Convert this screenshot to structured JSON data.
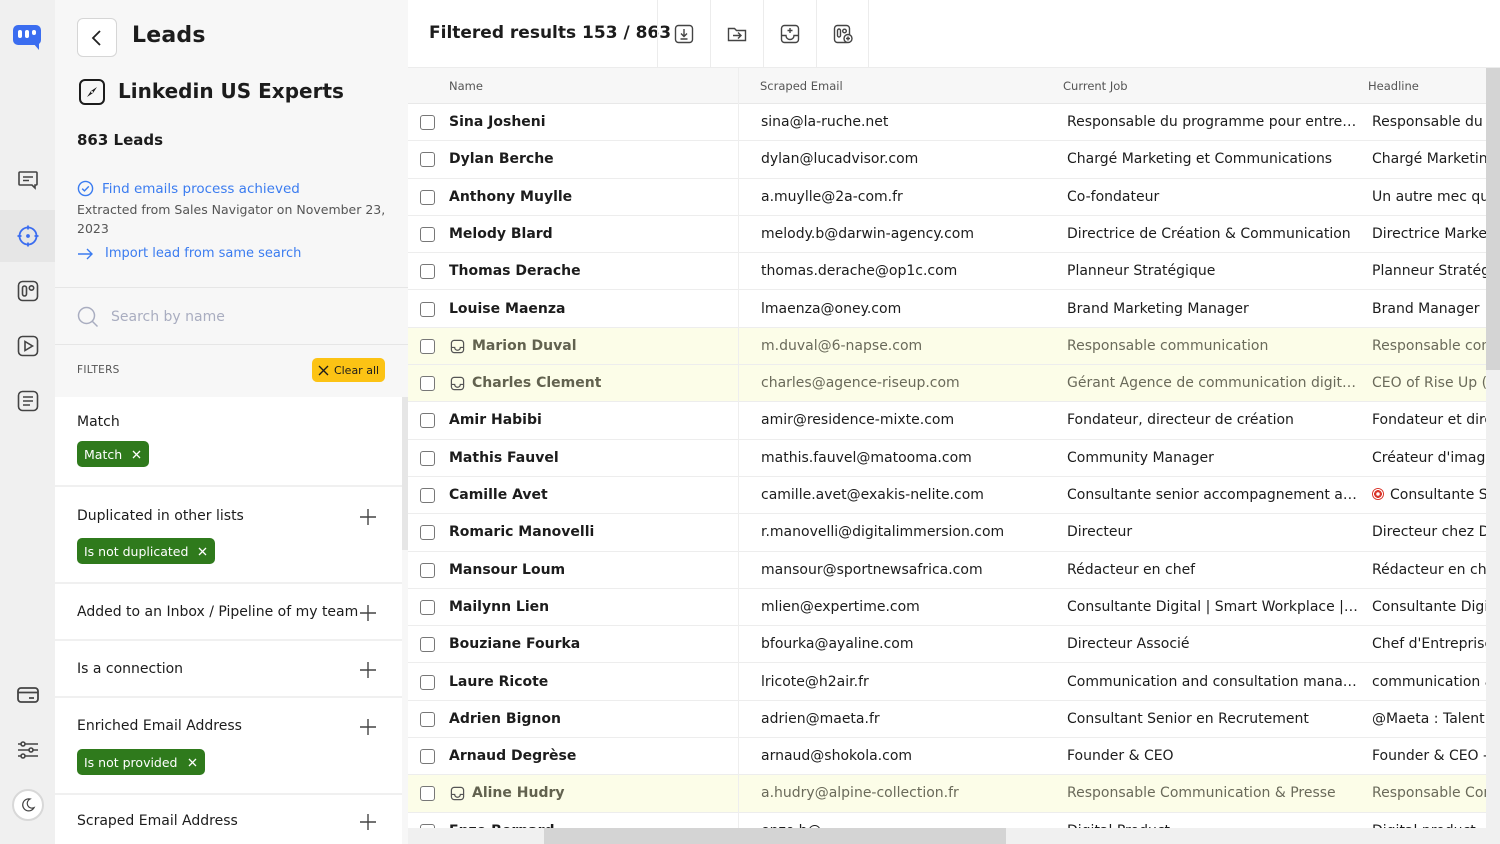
{
  "rail": {
    "items": [
      {
        "name": "messages",
        "icon": "chat-icon"
      },
      {
        "name": "prospecting",
        "icon": "target-icon",
        "active": true
      },
      {
        "name": "campaigns",
        "icon": "counter-icon"
      },
      {
        "name": "sequences",
        "icon": "play-icon"
      },
      {
        "name": "templates",
        "icon": "document-icon"
      },
      {
        "name": "billing",
        "icon": "credit-card-icon"
      },
      {
        "name": "settings",
        "icon": "sliders-icon"
      },
      {
        "name": "dark-mode",
        "icon": "moon-icon"
      }
    ],
    "accent": "#3b6df0"
  },
  "panel": {
    "title": "Leads",
    "list_name": "Linkedin US Experts",
    "lead_count": "863 Leads",
    "status": "Find emails process achieved",
    "extracted": "Extracted from Sales Navigator on November 23, 2023",
    "import_link": "Import lead from same search",
    "search_placeholder": "Search by name",
    "filters_label": "FILTERS",
    "clear_all": "Clear all",
    "filters": [
      {
        "label": "Match",
        "chip": "Match",
        "has_plus": false
      },
      {
        "label": "Duplicated in other lists",
        "chip": "Is not duplicated",
        "has_plus": true
      },
      {
        "label": "Added to an Inbox / Pipeline of my team",
        "chip": null,
        "has_plus": true
      },
      {
        "label": "Is a connection",
        "chip": null,
        "has_plus": true
      },
      {
        "label": "Enriched Email Address",
        "chip": "Is not provided",
        "has_plus": true
      },
      {
        "label": "Scraped Email Address",
        "chip": null,
        "has_plus": true
      }
    ]
  },
  "main": {
    "filtered_results": "Filtered results 153 / 863",
    "toolbar": [
      {
        "name": "export-button",
        "icon": "download-icon"
      },
      {
        "name": "move-to-list-button",
        "icon": "folder-arrow-icon"
      },
      {
        "name": "add-to-inbox-button",
        "icon": "inbox-plus-icon"
      },
      {
        "name": "add-to-campaign-button",
        "icon": "campaign-plus-icon"
      }
    ],
    "columns": [
      "Name",
      "Scraped Email",
      "Current Job",
      "Headline"
    ],
    "rows": [
      {
        "name": "Sina Josheni",
        "email": "sina@la-ruche.net",
        "job": "Responsable du programme pour entrepre...",
        "headline": "Responsable du p",
        "inbox": false
      },
      {
        "name": "Dylan Berche",
        "email": "dylan@lucadvisor.com",
        "job": "Chargé Marketing et Communications",
        "headline": "Chargé Marketing",
        "inbox": false
      },
      {
        "name": "Anthony Muylle",
        "email": "a.muylle@2a-com.fr",
        "job": "Co-fondateur",
        "headline": "Un autre mec qui",
        "inbox": false
      },
      {
        "name": "Melody Blard",
        "email": "melody.b@darwin-agency.com",
        "job": "Directrice de Création & Communication",
        "headline": "Directrice Market",
        "inbox": false
      },
      {
        "name": "Thomas Derache",
        "email": "thomas.derache@op1c.com",
        "job": "Planneur Stratégique",
        "headline": "Planneur Stratég",
        "inbox": false
      },
      {
        "name": "Louise Maenza",
        "email": "lmaenza@oney.com",
        "job": "Brand Marketing Manager",
        "headline": "Brand Manager",
        "inbox": false
      },
      {
        "name": "Marion Duval",
        "email": "m.duval@6-napse.com",
        "job": "Responsable communication",
        "headline": "Responsable com",
        "inbox": true
      },
      {
        "name": "Charles Clement",
        "email": "charles@agence-riseup.com",
        "job": "Gérant Agence de communication digitale",
        "headline": "CEO of Rise Up (D",
        "inbox": true
      },
      {
        "name": "Amir Habibi",
        "email": "amir@residence-mixte.com",
        "job": "Fondateur, directeur de création",
        "headline": "Fondateur et dire",
        "inbox": false
      },
      {
        "name": "Mathis Fauvel",
        "email": "mathis.fauvel@matooma.com",
        "job": "Community Manager",
        "headline": "Créateur d'image",
        "inbox": false
      },
      {
        "name": "Camille Avet",
        "email": "camille.avet@exakis-nelite.com",
        "job": "Consultante senior accompagnement au c...",
        "headline": "Consultante Se",
        "headline_emoji": true,
        "inbox": false
      },
      {
        "name": "Romaric Manovelli",
        "email": "r.manovelli@digitalimmersion.com",
        "job": "Directeur",
        "headline": "Directeur chez Di",
        "inbox": false
      },
      {
        "name": "Mansour Loum",
        "email": "mansour@sportnewsafrica.com",
        "job": "Rédacteur en chef",
        "headline": "Rédacteur en che",
        "inbox": false
      },
      {
        "name": "Mailynn Lien",
        "email": "mlien@expertime.com",
        "job": "Consultante Digital | Smart Workplace | Fo...",
        "headline": "Consultante Digit",
        "inbox": false
      },
      {
        "name": "Bouziane Fourka",
        "email": "bfourka@ayaline.com",
        "job": "Directeur Associé",
        "headline": "Chef d'Entreprise",
        "inbox": false
      },
      {
        "name": "Laure Ricote",
        "email": "lricote@h2air.fr",
        "job": "Communication and consultation manager",
        "headline": "communication a",
        "inbox": false
      },
      {
        "name": "Adrien Bignon",
        "email": "adrien@maeta.fr",
        "job": "Consultant Senior en Recrutement",
        "headline": "@Maeta : Talent .",
        "inbox": false
      },
      {
        "name": "Arnaud Degrèse",
        "email": "arnaud@shokola.com",
        "job": "Founder & CEO",
        "headline": "Founder & CEO -",
        "inbox": false
      },
      {
        "name": "Aline Hudry",
        "email": "a.hudry@alpine-collection.fr",
        "job": "Responsable Communication & Presse",
        "headline": "Responsable Con",
        "inbox": true
      },
      {
        "name": "Enzo Bernard",
        "email": "enzo.b@...",
        "job": "Digital Product...",
        "headline": "Digital product",
        "inbox": false
      }
    ]
  }
}
